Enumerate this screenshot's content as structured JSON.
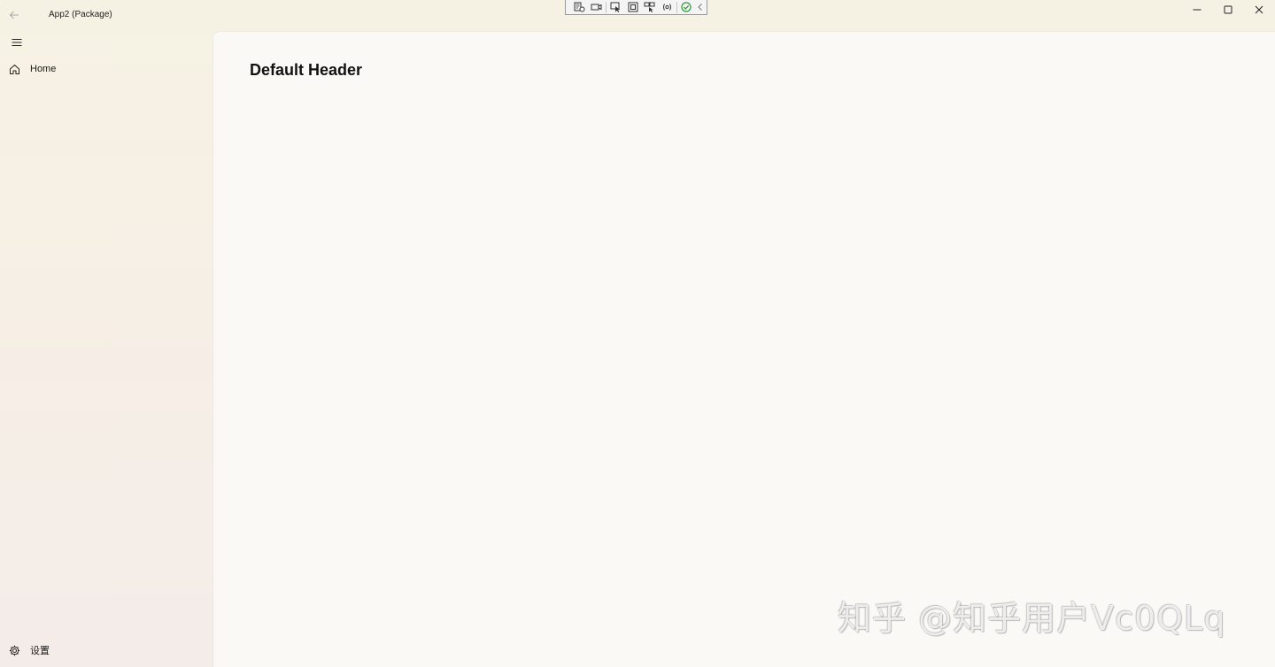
{
  "window": {
    "title": "App2 (Package)",
    "back_icon": "arrow-left-icon",
    "caption_buttons": [
      "minimize-icon",
      "maximize-icon",
      "close-icon"
    ]
  },
  "debug_toolbar": {
    "icons": [
      "live-visual-tree-icon",
      "video-camera-icon",
      "select-element-icon",
      "display-layout-adorners-icon",
      "track-focus-icon",
      "binding-failures-icon",
      "accessibility-check-icon",
      "collapse-toolbar-icon"
    ],
    "accent_color": "#2e9b3a"
  },
  "nav": {
    "menu_icon": "hamburger-menu-icon",
    "items": [
      {
        "label": "Home",
        "icon": "home-icon"
      }
    ],
    "footer": {
      "label": "设置",
      "icon": "gear-icon"
    }
  },
  "content": {
    "header": "Default Header"
  },
  "watermark": {
    "text": "知乎 @知乎用户Vc0QLq"
  }
}
